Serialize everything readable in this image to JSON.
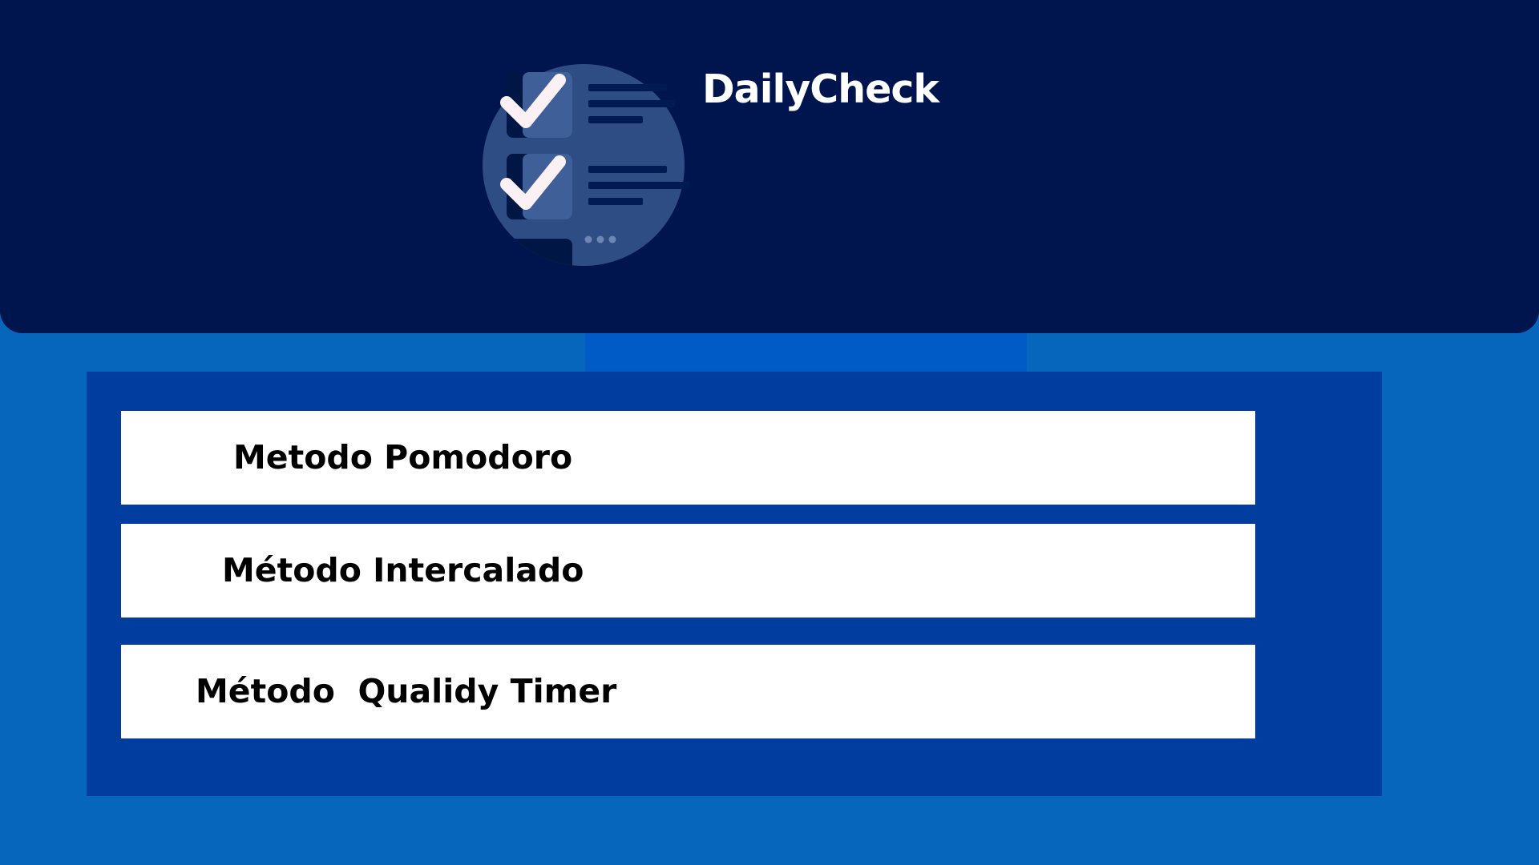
{
  "app": {
    "title": "DailyCheck",
    "logo_icon": "checklist-icon"
  },
  "methods": [
    {
      "label": "Metodo Pomodoro"
    },
    {
      "label": "Método Intercalado"
    },
    {
      "label": "Método  Qualidy Timer"
    }
  ],
  "colors": {
    "background": "#0566bc",
    "header": "#00154d",
    "panel": "#003d9f",
    "connector": "#005bc7",
    "button": "#ffffff",
    "button_text": "#000000",
    "title_text": "#ffffff"
  }
}
